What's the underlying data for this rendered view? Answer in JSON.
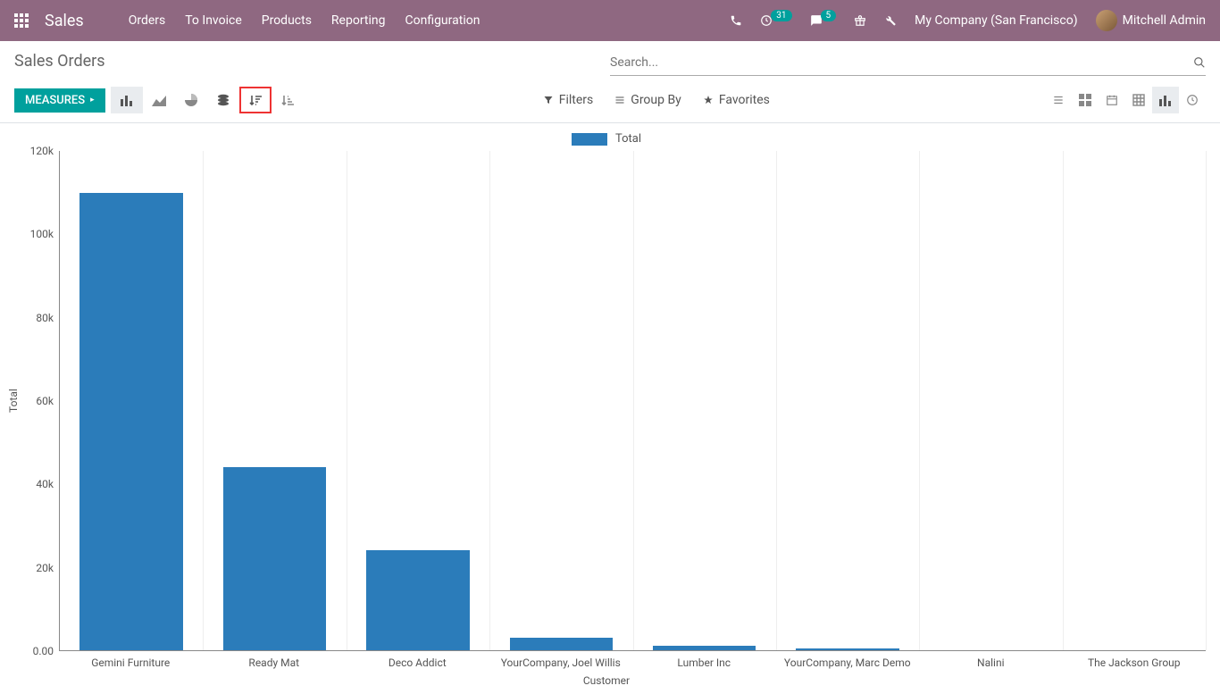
{
  "navbar": {
    "brand": "Sales",
    "menu": [
      "Orders",
      "To Invoice",
      "Products",
      "Reporting",
      "Configuration"
    ],
    "activity_count": "31",
    "messages_count": "5",
    "company": "My Company (San Francisco)",
    "user": "Mitchell Admin"
  },
  "breadcrumb": {
    "title": "Sales Orders"
  },
  "search": {
    "placeholder": "Search..."
  },
  "toolbar": {
    "measures_label": "MEASURES",
    "filters_label": "Filters",
    "groupby_label": "Group By",
    "favorites_label": "Favorites"
  },
  "legend": {
    "label": "Total"
  },
  "chart_data": {
    "type": "bar",
    "categories": [
      "Gemini Furniture",
      "Ready Mat",
      "Deco Addict",
      "YourCompany, Joel Willis",
      "Lumber Inc",
      "YourCompany, Marc Demo",
      "Nalini",
      "The Jackson Group"
    ],
    "values": [
      110000,
      44000,
      24000,
      3000,
      1000,
      500,
      0,
      0
    ],
    "title": "",
    "xlabel": "Customer",
    "ylabel": "Total",
    "ylim": [
      0,
      120000
    ],
    "yticks": [
      {
        "v": 0,
        "l": "0.00"
      },
      {
        "v": 20000,
        "l": "20k"
      },
      {
        "v": 40000,
        "l": "40k"
      },
      {
        "v": 60000,
        "l": "60k"
      },
      {
        "v": 80000,
        "l": "80k"
      },
      {
        "v": 100000,
        "l": "100k"
      },
      {
        "v": 120000,
        "l": "120k"
      }
    ],
    "bar_color": "#2b7cba"
  }
}
